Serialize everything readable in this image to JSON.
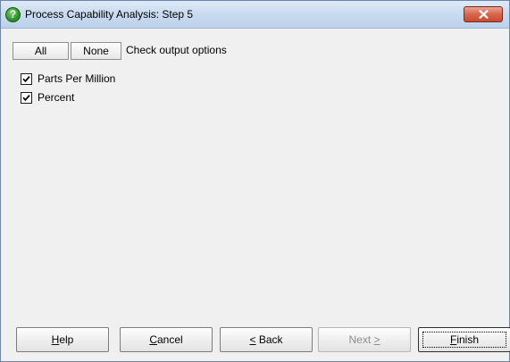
{
  "window": {
    "title": "Process Capability Analysis: Step 5"
  },
  "toolbar": {
    "all_label": "All",
    "none_label": "None",
    "hint": "Check output options"
  },
  "options": [
    {
      "label": "Parts Per Million",
      "checked": true
    },
    {
      "label": "Percent",
      "checked": true
    }
  ],
  "buttons": {
    "help": {
      "mnemonic": "H",
      "rest": "elp"
    },
    "cancel": {
      "mnemonic": "C",
      "rest": "ancel"
    },
    "back": {
      "mnemonic": "<",
      "rest": " Back"
    },
    "next": {
      "pre": "Next ",
      "mnemonic": ">",
      "disabled": true
    },
    "finish": {
      "mnemonic": "F",
      "rest": "inish"
    }
  }
}
